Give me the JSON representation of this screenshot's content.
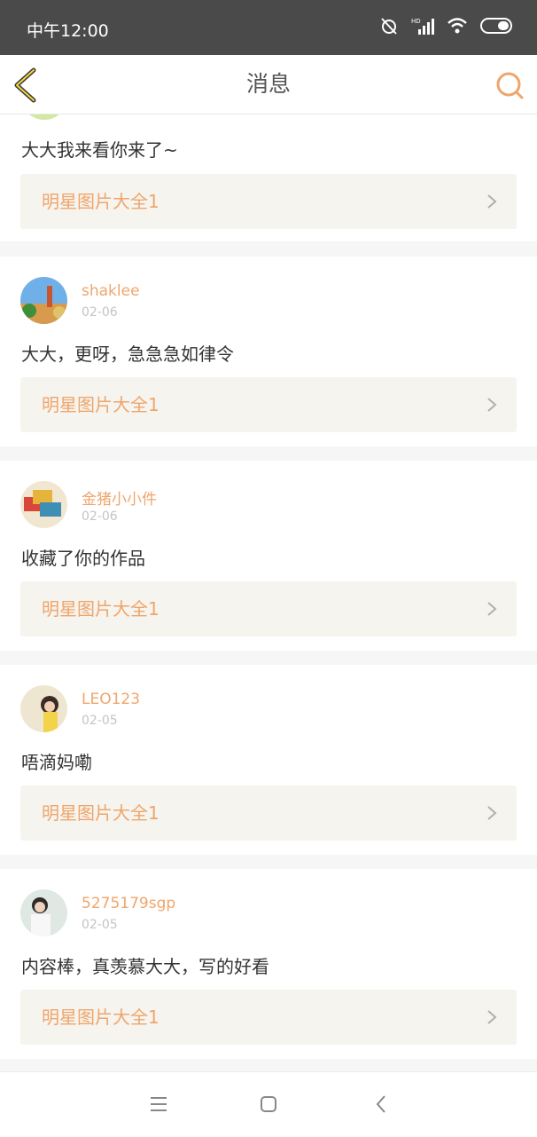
{
  "status_bar": {
    "time": "中午12:00"
  },
  "header": {
    "title": "消息"
  },
  "colors": {
    "accent": "#f0a56b",
    "link_bg": "#f5f4ee",
    "status_bg": "#4a4a4a"
  },
  "messages": [
    {
      "user": "",
      "date": "",
      "comment": "大大我来看你来了~",
      "link": "明星图片大全1",
      "avatar": "green-avatar"
    },
    {
      "user": "shaklee",
      "date": "02-06",
      "comment": "大大，更呀，急急急如律令",
      "link": "明星图片大全1",
      "avatar": "park-avatar"
    },
    {
      "user": "金猪小小件",
      "date": "02-06",
      "comment": "收藏了你的作品",
      "link": "明星图片大全1",
      "avatar": "notebooks-avatar"
    },
    {
      "user": "LEO123",
      "date": "02-05",
      "comment": "唔滴妈嘞",
      "link": "明星图片大全1",
      "avatar": "girl-avatar"
    },
    {
      "user": "5275179sgp",
      "date": "02-05",
      "comment": "内容棒，真羡慕大大，写的好看",
      "link": "明星图片大全1",
      "avatar": "person-avatar"
    }
  ],
  "system_nav": {
    "icons": [
      "menu-icon",
      "home-icon",
      "back-icon"
    ]
  }
}
